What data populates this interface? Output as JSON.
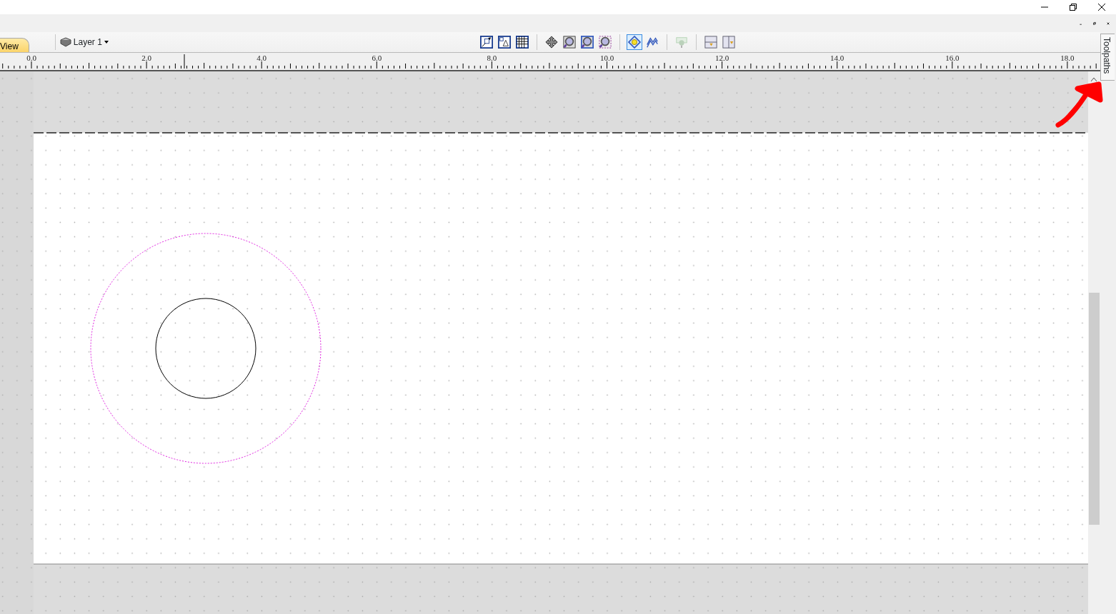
{
  "tabs": [
    {
      "label": "View",
      "selected": true
    }
  ],
  "layer": {
    "label": "Layer 1"
  },
  "toolbar": [
    {
      "kind": "square-arrow",
      "selected": false,
      "disabled": false
    },
    {
      "kind": "triangle",
      "selected": false,
      "disabled": false
    },
    {
      "kind": "grid",
      "selected": false,
      "disabled": false
    },
    {
      "kind": "separator"
    },
    {
      "kind": "move",
      "selected": false,
      "disabled": false
    },
    {
      "kind": "zoom-box",
      "selected": false,
      "disabled": false
    },
    {
      "kind": "zoom-fit",
      "selected": false,
      "disabled": false
    },
    {
      "kind": "zoom-dashed",
      "selected": false,
      "disabled": false
    },
    {
      "kind": "separator"
    },
    {
      "kind": "bulb",
      "selected": true,
      "disabled": false
    },
    {
      "kind": "wave",
      "selected": false,
      "disabled": false
    },
    {
      "kind": "separator"
    },
    {
      "kind": "cutter",
      "selected": false,
      "disabled": true
    },
    {
      "kind": "separator"
    },
    {
      "kind": "panel-h",
      "selected": false,
      "disabled": false
    },
    {
      "kind": "panel-v",
      "selected": false,
      "disabled": false
    }
  ],
  "ruler": {
    "labels": [
      "0.0",
      "2.0",
      "4.0",
      "6.0",
      "8.0",
      "10.0",
      "12.0",
      "14.0",
      "16.0",
      "18.0"
    ]
  },
  "side_tab": {
    "label": "Toolpaths"
  }
}
